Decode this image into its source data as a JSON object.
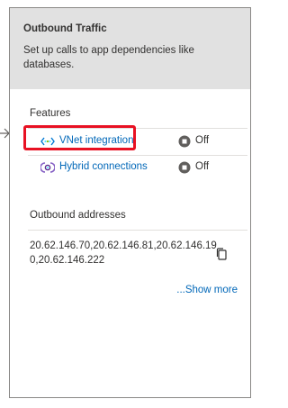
{
  "header": {
    "title": "Outbound Traffic",
    "description": "Set up calls to app dependencies like databases."
  },
  "features": {
    "label": "Features",
    "items": [
      {
        "name": "VNet integration",
        "status": "Off",
        "icon": "vnet-icon"
      },
      {
        "name": "Hybrid connections",
        "status": "Off",
        "icon": "hybrid-connections-icon"
      }
    ]
  },
  "outbound": {
    "label": "Outbound addresses",
    "addresses": "20.62.146.70,20.62.146.81,20.62.146.190,20.62.146.222",
    "show_more": "...Show more"
  },
  "colors": {
    "link": "#0067b8",
    "highlight": "#e81123",
    "header_bg": "#e1e1e1"
  }
}
